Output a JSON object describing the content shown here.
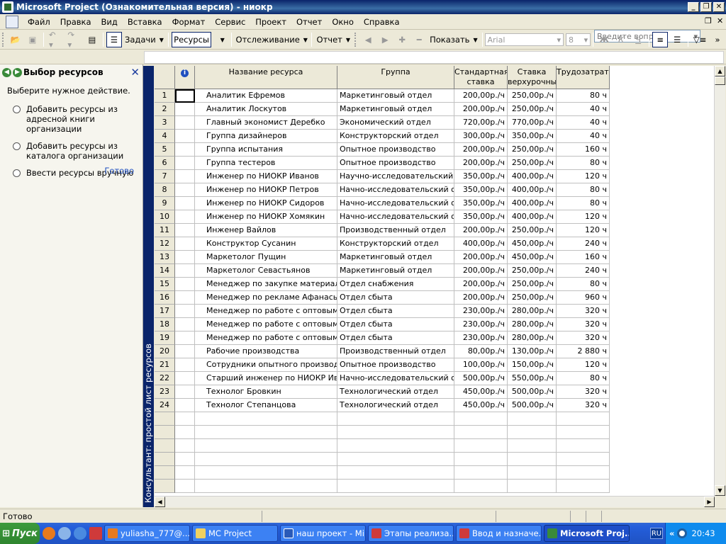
{
  "window": {
    "title": "Microsoft Project (Ознакомительная версия) - ниокр"
  },
  "menu": {
    "items": [
      "Файл",
      "Правка",
      "Вид",
      "Вставка",
      "Формат",
      "Сервис",
      "Проект",
      "Отчет",
      "Окно",
      "Справка"
    ],
    "ask_placeholder": "Введите вопрос"
  },
  "toolbar": {
    "tasks": "Задачи",
    "resources": "Ресурсы",
    "tracking": "Отслеживание",
    "report": "Отчет",
    "show": "Показать",
    "font": "Arial",
    "size": "8",
    "bold": "Ж",
    "italic": "К",
    "underline": "Ч"
  },
  "taskpane": {
    "title": "Выбор ресурсов",
    "intro": "Выберите нужное действие.",
    "options": [
      "Добавить ресурсы из адресной книги организации",
      "Добавить ресурсы из каталога организации",
      "Ввести ресурсы вручную"
    ],
    "done": "Готово"
  },
  "banner": "Консультант: простой лист ресурсов",
  "table": {
    "headers": {
      "name": "Название ресурса",
      "group": "Группа",
      "std_rate": "Стандартная ставка",
      "ovt_rate": "Ставка верхурочны",
      "work": "Трудозатрать"
    },
    "rows": [
      {
        "id": "1",
        "name": "Аналитик Ефремов",
        "group": "Маркетинговый отдел",
        "std": "200,00р./ч",
        "ovt": "250,00р./ч",
        "work": "80 ч"
      },
      {
        "id": "2",
        "name": "Аналитик Лоскутов",
        "group": "Маркетинговый отдел",
        "std": "200,00р./ч",
        "ovt": "250,00р./ч",
        "work": "40 ч"
      },
      {
        "id": "3",
        "name": "Главный экономист Деребко",
        "group": "Экономический отдел",
        "std": "720,00р./ч",
        "ovt": "770,00р./ч",
        "work": "40 ч"
      },
      {
        "id": "4",
        "name": "Группа дизайнеров",
        "group": "Конструкторский отдел",
        "std": "300,00р./ч",
        "ovt": "350,00р./ч",
        "work": "40 ч"
      },
      {
        "id": "5",
        "name": "Группа испытания",
        "group": "Опытное производство",
        "std": "200,00р./ч",
        "ovt": "250,00р./ч",
        "work": "160 ч"
      },
      {
        "id": "6",
        "name": "Группа тестеров",
        "group": "Опытное производство",
        "std": "200,00р./ч",
        "ovt": "250,00р./ч",
        "work": "80 ч"
      },
      {
        "id": "7",
        "name": "Инженер по НИОКР Иванов",
        "group": "Научно-исследовательский от,",
        "std": "350,00р./ч",
        "ovt": "400,00р./ч",
        "work": "120 ч"
      },
      {
        "id": "8",
        "name": "Инженер по НИОКР Петров",
        "group": "Начно-исследовательский отд",
        "std": "350,00р./ч",
        "ovt": "400,00р./ч",
        "work": "80 ч"
      },
      {
        "id": "9",
        "name": "Инженер по НИОКР Сидоров",
        "group": "Начно-исследовательский отд",
        "std": "350,00р./ч",
        "ovt": "400,00р./ч",
        "work": "80 ч"
      },
      {
        "id": "10",
        "name": "Инженер по НИОКР Хомякин",
        "group": "Начно-исследовательский отд",
        "std": "350,00р./ч",
        "ovt": "400,00р./ч",
        "work": "120 ч"
      },
      {
        "id": "11",
        "name": "Инженер Вайлов",
        "group": "Производственный отдел",
        "std": "200,00р./ч",
        "ovt": "250,00р./ч",
        "work": "120 ч"
      },
      {
        "id": "12",
        "name": "Конструктор Сусанин",
        "group": "Конструкторский отдел",
        "std": "400,00р./ч",
        "ovt": "450,00р./ч",
        "work": "240 ч"
      },
      {
        "id": "13",
        "name": "Маркетолог Пущин",
        "group": "Маркетинговый отдел",
        "std": "200,00р./ч",
        "ovt": "450,00р./ч",
        "work": "160 ч"
      },
      {
        "id": "14",
        "name": "Маркетолог Севастьянов",
        "group": "Маркетинговый отдел",
        "std": "200,00р./ч",
        "ovt": "250,00р./ч",
        "work": "240 ч"
      },
      {
        "id": "15",
        "name": "Менеджер по закупке материалов Р",
        "group": "Отдел снабжения",
        "std": "200,00р./ч",
        "ovt": "250,00р./ч",
        "work": "80 ч"
      },
      {
        "id": "16",
        "name": "Менеджер по рекламе Афанасьев",
        "group": "Отдел сбыта",
        "std": "200,00р./ч",
        "ovt": "250,00р./ч",
        "work": "960 ч"
      },
      {
        "id": "17",
        "name": "Менеджер по работе с оптовыми по",
        "group": "Отдел сбыта",
        "std": "230,00р./ч",
        "ovt": "280,00р./ч",
        "work": "320 ч"
      },
      {
        "id": "18",
        "name": "Менеджер по работе с оптовыми по",
        "group": "Отдел сбыта",
        "std": "230,00р./ч",
        "ovt": "280,00р./ч",
        "work": "320 ч"
      },
      {
        "id": "19",
        "name": "Менеджер по работе с оптовыми по",
        "group": "Отдел сбыта",
        "std": "230,00р./ч",
        "ovt": "280,00р./ч",
        "work": "320 ч"
      },
      {
        "id": "20",
        "name": "Рабочие производства",
        "group": "Производственный отдел",
        "std": "80,00р./ч",
        "ovt": "130,00р./ч",
        "work": "2 880 ч"
      },
      {
        "id": "21",
        "name": "Сотрудники опытного производств",
        "group": "Опытное производство",
        "std": "100,00р./ч",
        "ovt": "150,00р./ч",
        "work": "120 ч"
      },
      {
        "id": "22",
        "name": "Старший инженер по НИОКР Ивано",
        "group": "Начно-исследовательский отд",
        "std": "500,00р./ч",
        "ovt": "550,00р./ч",
        "work": "80 ч"
      },
      {
        "id": "23",
        "name": "Технолог Бровкин",
        "group": "Технологический отдел",
        "std": "450,00р./ч",
        "ovt": "500,00р./ч",
        "work": "320 ч"
      },
      {
        "id": "24",
        "name": "Технолог Степанцова",
        "group": "Технологический отдел",
        "std": "450,00р./ч",
        "ovt": "500,00р./ч",
        "work": "320 ч"
      }
    ],
    "blank_rows": 6
  },
  "status": {
    "text": "Готово"
  },
  "taskbar": {
    "start": "Пуск",
    "tasks": [
      "yuliasha_777@...",
      "МС Project",
      "наш проект - Mi...",
      "Этапы реализа...",
      "Ввод и назначе...",
      "Microsoft Proj..."
    ],
    "lang": "RU",
    "clock": "20:43"
  }
}
